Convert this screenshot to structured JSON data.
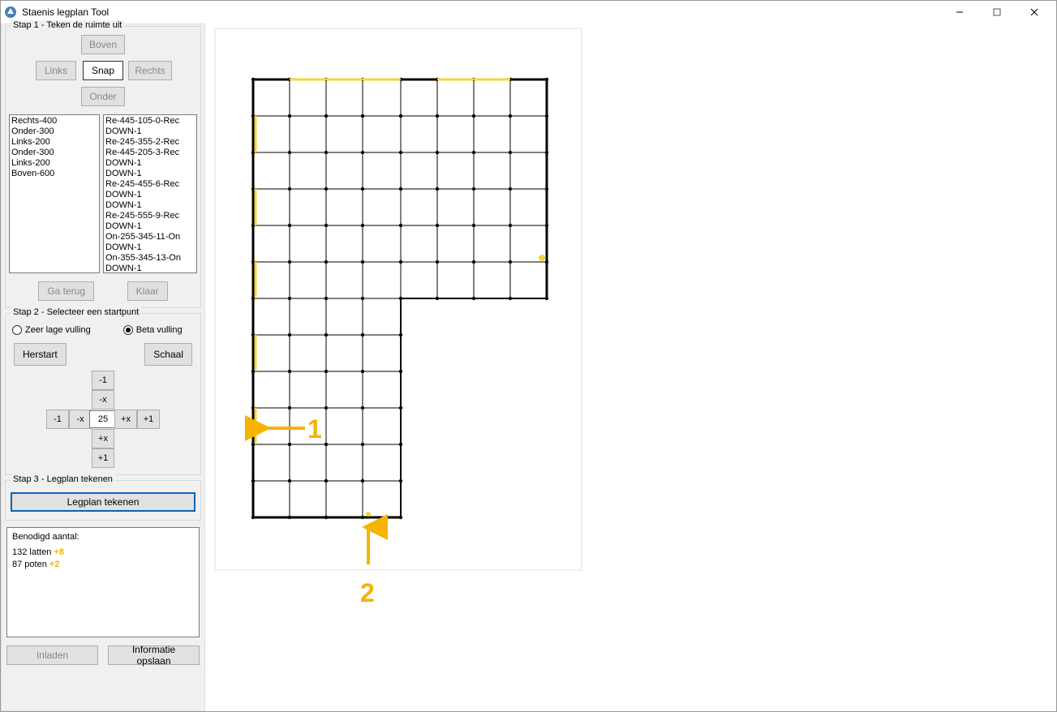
{
  "window": {
    "title": "Staenis legplan Tool",
    "controls": {
      "minimize": "—",
      "maximize": "▢",
      "close": "✕"
    }
  },
  "step1": {
    "legend": "Stap 1 - Teken de ruimte uit",
    "buttons": {
      "boven": "Boven",
      "links": "Links",
      "snap": "Snap",
      "rechts": "Rechts",
      "onder": "Onder"
    },
    "back": "Ga terug",
    "done": "Klaar",
    "list_left": [
      "Rechts-400",
      "Onder-300",
      "Links-200",
      "Onder-300",
      "Links-200",
      "Boven-600"
    ],
    "list_right": [
      "Re-445-105-0-Rec",
      "DOWN-1",
      "Re-245-355-2-Rec",
      "Re-445-205-3-Rec",
      "DOWN-1",
      "DOWN-1",
      "Re-245-455-6-Rec",
      "DOWN-1",
      "DOWN-1",
      "Re-245-555-9-Rec",
      "DOWN-1",
      "On-255-345-11-On",
      "DOWN-1",
      "On-355-345-13-On",
      "DOWN-1"
    ]
  },
  "step2": {
    "legend": "Stap 2 - Selecteer een startpunt",
    "radio": {
      "low": "Zeer lage vulling",
      "beta": "Beta vulling"
    },
    "restart": "Herstart",
    "scale": "Schaal",
    "adjust": {
      "minus1_top": "-1",
      "minusx_top": "-x",
      "minus1_left": "-1",
      "minusx_left": "-x",
      "value": "25",
      "plusx_right": "+x",
      "plus1_right": "+1",
      "plusx_bottom": "+x",
      "plus1_bottom": "+1"
    }
  },
  "step3": {
    "legend": "Stap 3 - Legplan tekenen",
    "draw": "Legplan tekenen"
  },
  "results": {
    "title": "Benodigd aantal:",
    "row1_text": "132 latten ",
    "row1_plus": "+8",
    "row2_text": "87 poten ",
    "row2_plus": "+2"
  },
  "bottom": {
    "load": "Inladen",
    "save": "Informatie opslaan"
  },
  "canvas": {
    "marker1": "1",
    "marker2": "2"
  }
}
